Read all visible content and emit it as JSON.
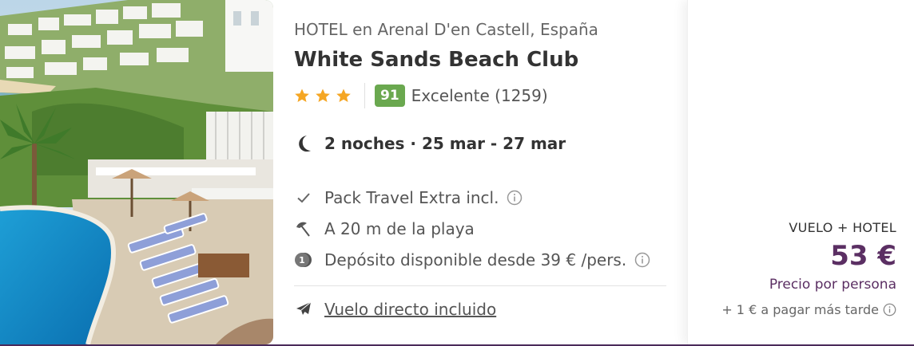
{
  "hotel": {
    "location": "HOTEL en Arenal D'en Castell, España",
    "name": "White Sands Beach Club",
    "stars": 3,
    "score": "91",
    "score_label": "Excelente (1259)",
    "photo_icon": "hotel-photo"
  },
  "stay": {
    "nights": "2 noches · 25 mar - 27 mar",
    "icon": "moon-icon"
  },
  "features": [
    {
      "text": "Pack Travel Extra incl.",
      "icon": "check-icon",
      "has_info": true
    },
    {
      "text": "A 20 m de la playa",
      "icon": "beach-umbrella-icon",
      "has_info": false
    },
    {
      "text": "Depósito disponible desde 39 € /pers.",
      "icon": "deposit-coin-icon",
      "has_info": true
    }
  ],
  "flight": {
    "label": "Vuelo directo incluido",
    "icon": "plane-icon"
  },
  "price": {
    "type": "VUELO + HOTEL",
    "amount": "53 €",
    "per_person": "Precio por persona",
    "later": "+ 1 € a pagar más tarde"
  },
  "colors": {
    "price_accent": "#5b2f63",
    "score_badge": "#6aa84f",
    "star": "#f5a623"
  }
}
